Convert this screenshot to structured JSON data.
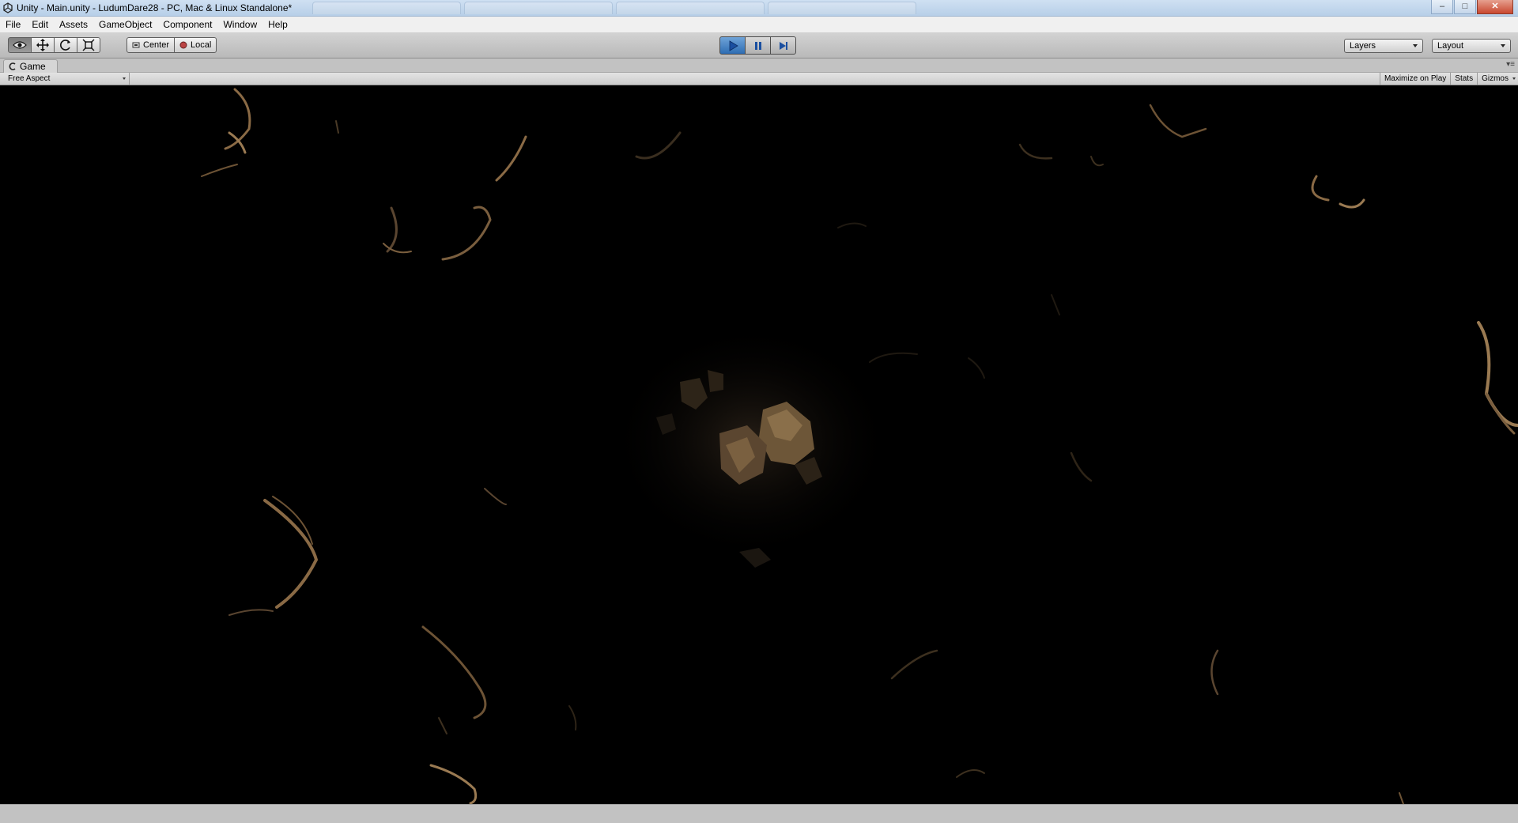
{
  "window": {
    "title": "Unity - Main.unity - LudumDare28 - PC, Mac & Linux Standalone*",
    "background_tabs": [
      "",
      "",
      "",
      ""
    ],
    "controls": {
      "minimize": "–",
      "maximize": "□",
      "close": "✕"
    }
  },
  "menu": {
    "items": [
      "File",
      "Edit",
      "Assets",
      "GameObject",
      "Component",
      "Window",
      "Help"
    ]
  },
  "toolbar": {
    "tools": [
      {
        "name": "hand",
        "icon": "eye-icon",
        "active": true
      },
      {
        "name": "move",
        "icon": "move-arrows-icon",
        "active": false
      },
      {
        "name": "rotate",
        "icon": "rotate-icon",
        "active": false
      },
      {
        "name": "scale",
        "icon": "scale-icon",
        "active": false
      }
    ],
    "pivot_label": "Center",
    "space_label": "Local",
    "play_state": "playing",
    "layers_label": "Layers",
    "layout_label": "Layout"
  },
  "panel": {
    "tab_label": "Game",
    "aspect_label": "Free Aspect",
    "maximize_label": "Maximize on Play",
    "stats_label": "Stats",
    "gizmos_label": "Gizmos"
  },
  "colors": {
    "play_accent": "#2e6db3",
    "game_background": "#000000",
    "rock_highlight": "#b08a5e",
    "rock_shadow": "#4a3520"
  }
}
